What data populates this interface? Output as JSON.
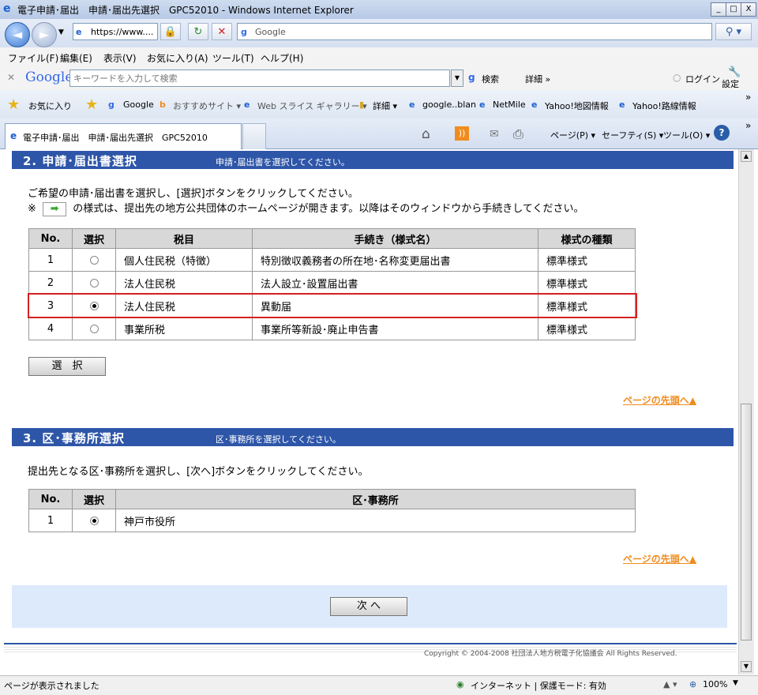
{
  "window": {
    "title": "電子申請･届出　申請･届出先選択　GPC52010 - Windows Internet Explorer",
    "min_label": "_",
    "max_label": "□",
    "close_label": "X"
  },
  "addressbar": {
    "url": "https://www....",
    "search_value": "Google"
  },
  "menu": [
    "ファイル(F)",
    "編集(E)",
    "表示(V)",
    "お気に入り(A)",
    "ツール(T)",
    "ヘルプ(H)"
  ],
  "google_toolbar": {
    "logo": "Google",
    "placeholder": "キーワードを入力して検索",
    "search_label": "検索",
    "more_label": "詳細 »",
    "login_label": "ログイン",
    "settings_label": "設定"
  },
  "favorites": {
    "label": "お気に入り",
    "items": [
      "Google",
      "おすすめサイト ▾",
      "Web スライス ギャラリー ▾",
      "詳細 ▾",
      "google..blan",
      "NetMile",
      "Yahoo!地図情報",
      "Yahoo!路線情報"
    ]
  },
  "tab": {
    "label": "電子申請･届出　申請･届出先選択　GPC52010",
    "commands": [
      "ページ(P) ▾",
      "セーフティ(S) ▾",
      "ツール(O) ▾"
    ]
  },
  "section2": {
    "heading": "2. 申請･届出書選択",
    "sub": "申請･届出書を選択してください。",
    "instruction": "ご希望の申請･届出書を選択し、[選択]ボタンをクリックしてください。",
    "note_prefix": "※",
    "note": "の様式は、提出先の地方公共団体のホームページが開きます。以降はそのウィンドウから手続きしてください。",
    "columns": [
      "No.",
      "選択",
      "税目",
      "手続き（様式名）",
      "様式の種類"
    ],
    "rows": [
      {
        "no": "1",
        "selected": false,
        "tax": "個人住民税（特徴）",
        "procedure": "特別徴収義務者の所在地･名称変更届出書",
        "kind": "標準様式"
      },
      {
        "no": "2",
        "selected": false,
        "tax": "法人住民税",
        "procedure": "法人設立･設置届出書",
        "kind": "標準様式"
      },
      {
        "no": "3",
        "selected": true,
        "tax": "法人住民税",
        "procedure": "異動届",
        "kind": "標準様式"
      },
      {
        "no": "4",
        "selected": false,
        "tax": "事業所税",
        "procedure": "事業所等新設･廃止申告書",
        "kind": "標準様式"
      }
    ],
    "select_button": "選　択",
    "top_link": "ページの先頭へ▲"
  },
  "section3": {
    "heading": "3. 区･事務所選択",
    "sub": "区･事務所を選択してください。",
    "instruction": "提出先となる区･事務所を選択し、[次へ]ボタンをクリックしてください。",
    "columns": [
      "No.",
      "選択",
      "区･事務所"
    ],
    "rows": [
      {
        "no": "1",
        "selected": true,
        "office": "神戸市役所"
      }
    ],
    "top_link": "ページの先頭へ▲"
  },
  "next_button": "次 へ",
  "copyright": "Copyright © 2004-2008 社団法人地方税電子化協議会 All Rights Reserved.",
  "status": {
    "text": "ページが表示されました",
    "zone": "インターネット | 保護モード: 有効",
    "zoom": "100%"
  },
  "colors": {
    "section_bar": "#2e56a8",
    "link": "#f08c1e",
    "highlight_border": "#d62020",
    "footer_panel": "#ddeafc"
  }
}
